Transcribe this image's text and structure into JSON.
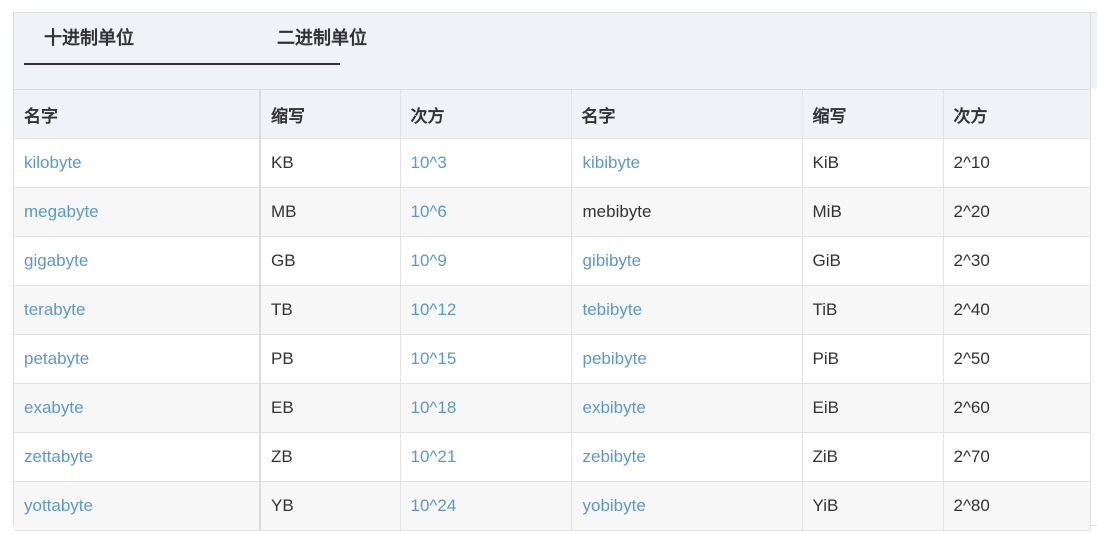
{
  "tabs": {
    "decimal": "十进制单位",
    "binary": "二进制单位"
  },
  "headers": {
    "dec_name": "名字",
    "dec_abbr": "缩写",
    "dec_power": "次方",
    "bin_name": "名字",
    "bin_abbr": "缩写",
    "bin_power": "次方"
  },
  "rows": [
    {
      "dec_name": "kilobyte",
      "dec_abbr": "KB",
      "dec_power": "10^3",
      "bin_name": "kibibyte",
      "bin_abbr": "KiB",
      "bin_power": "2^10"
    },
    {
      "dec_name": "megabyte",
      "dec_abbr": "MB",
      "dec_power": "10^6",
      "bin_name": "mebibyte",
      "bin_abbr": "MiB",
      "bin_power": "2^20"
    },
    {
      "dec_name": "gigabyte",
      "dec_abbr": "GB",
      "dec_power": "10^9",
      "bin_name": "gibibyte",
      "bin_abbr": "GiB",
      "bin_power": "2^30"
    },
    {
      "dec_name": "terabyte",
      "dec_abbr": "TB",
      "dec_power": "10^12",
      "bin_name": "tebibyte",
      "bin_abbr": "TiB",
      "bin_power": "2^40"
    },
    {
      "dec_name": "petabyte",
      "dec_abbr": "PB",
      "dec_power": "10^15",
      "bin_name": "pebibyte",
      "bin_abbr": "PiB",
      "bin_power": "2^50"
    },
    {
      "dec_name": "exabyte",
      "dec_abbr": "EB",
      "dec_power": "10^18",
      "bin_name": "exbibyte",
      "bin_abbr": "EiB",
      "bin_power": "2^60"
    },
    {
      "dec_name": "zettabyte",
      "dec_abbr": "ZB",
      "dec_power": "10^21",
      "bin_name": "zebibyte",
      "bin_abbr": "ZiB",
      "bin_power": "2^70"
    },
    {
      "dec_name": "yottabyte",
      "dec_abbr": "YB",
      "dec_power": "10^24",
      "bin_name": "yobibyte",
      "bin_abbr": "YiB",
      "bin_power": "2^80"
    }
  ],
  "colors": {
    "link": "#5a98cf",
    "text": "#333333",
    "header_bg": "#eff3f7",
    "stripe_bg": "#f7f7f7"
  }
}
